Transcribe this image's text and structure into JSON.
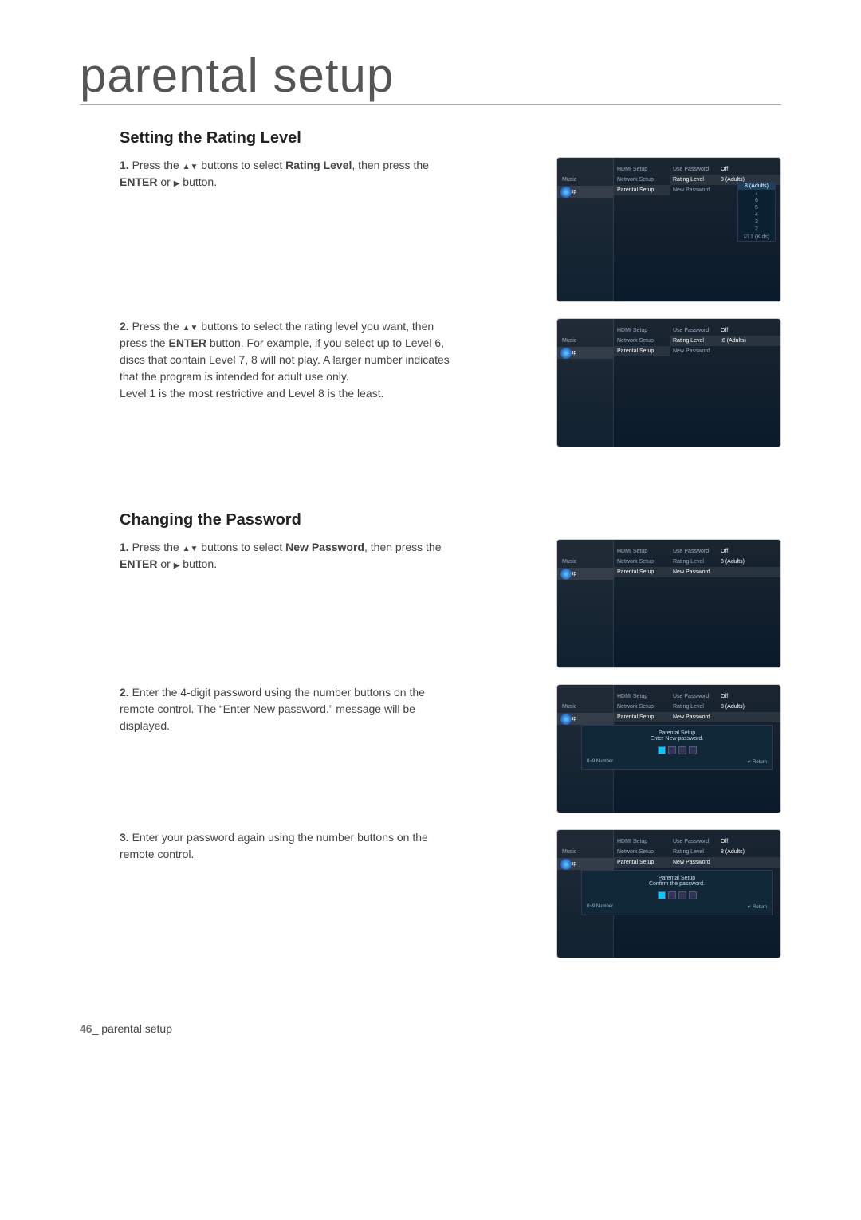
{
  "page_title": "parental setup",
  "footer": {
    "page_num": "46",
    "label": "_ parental setup"
  },
  "sections": {
    "rating": {
      "heading": "Setting the Rating Level",
      "step1": {
        "num": "1.",
        "pre": "Press the ",
        "mid": " buttons to select ",
        "target": "Rating Level",
        "post1": ", then press the ",
        "enter": "ENTER",
        "post2": " or ",
        "post3": " button."
      },
      "step2": {
        "num": "2.",
        "pre": "Press the ",
        "mid": " buttons to select the rating level you want, then press the ",
        "enter": "ENTER",
        "post1": " button. For example, if you select up to Level 6, discs that contain Level 7, 8 will not play. A larger number indicates that the program is intended for adult use only.",
        "line2": "Level 1 is the most restrictive and Level 8 is the least."
      }
    },
    "password": {
      "heading": "Changing the Password",
      "step1": {
        "num": "1.",
        "pre": "Press the ",
        "mid": " buttons to select ",
        "target": "New Password",
        "post1": ", then press the ",
        "enter": "ENTER",
        "post2": " or ",
        "post3": " button."
      },
      "step2": {
        "num": "2.",
        "text": "Enter the 4-digit password using the number buttons on the remote control. The “Enter New password.” message will be displayed."
      },
      "step3": {
        "num": "3.",
        "text": "Enter your password again using the number buttons on the remote control."
      }
    }
  },
  "ui": {
    "left": {
      "music": "Music",
      "setup": "Setup"
    },
    "mid": {
      "hdmi": "HDMI Setup",
      "network": "Network Setup",
      "parental": "Parental Setup"
    },
    "rows": {
      "use_password": "Use Password",
      "rating_level": "Rating Level",
      "new_password": "New Password",
      "off": "Off",
      "val8": "8 (Adults)"
    },
    "dropdown": {
      "adults": "8 (Adults)",
      "r7": "7",
      "r6": "6",
      "r5": "5",
      "r4": "4",
      "r3": "3",
      "r2": "2",
      "kids": "☑ 1 (Kids)"
    },
    "dialog": {
      "title_label": "Parental Setup",
      "enter_msg": "Enter New password.",
      "confirm_msg": "Confirm the password.",
      "number_btn": "0~9 Number",
      "return_btn": "↵ Return"
    }
  }
}
